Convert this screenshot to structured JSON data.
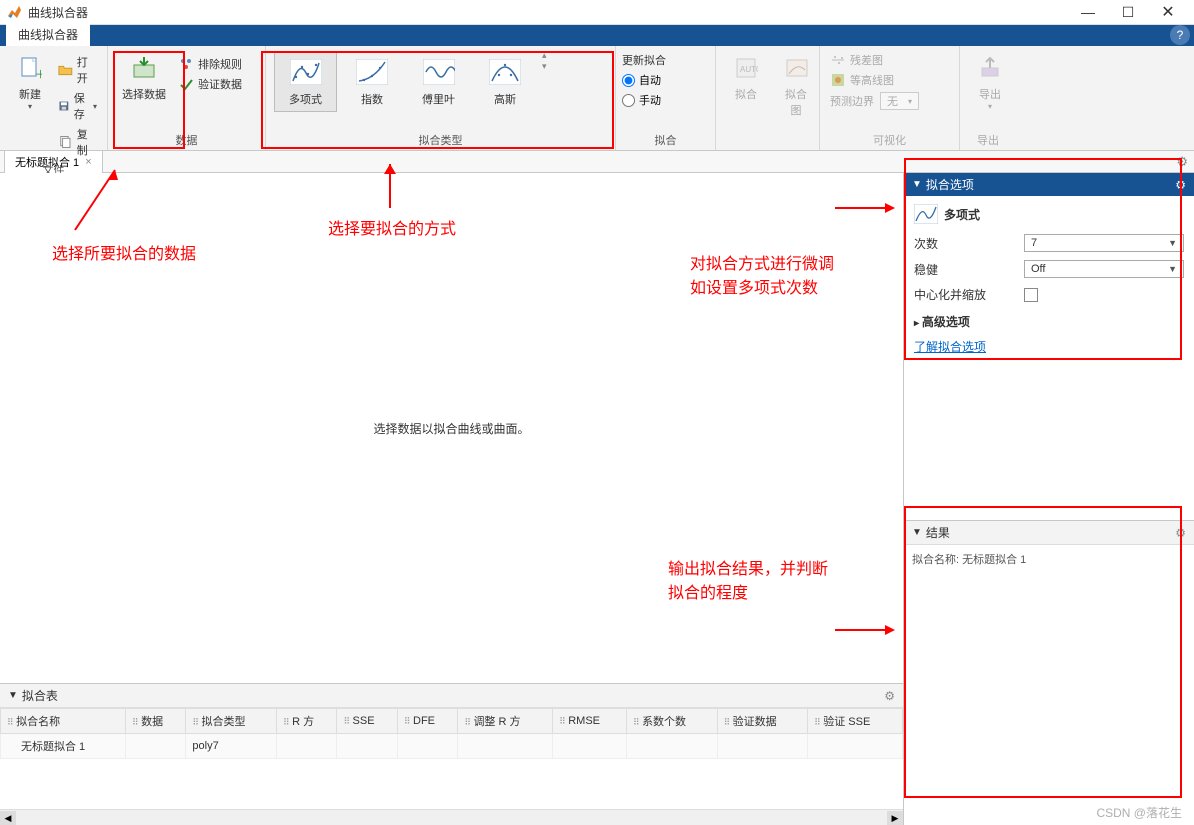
{
  "window": {
    "title": "曲线拟合器"
  },
  "ribbon": {
    "tab": "曲线拟合器",
    "file": {
      "new": "新建",
      "open": "打开",
      "save": "保存",
      "copy": "复制",
      "label": "文件"
    },
    "data": {
      "select": "选择数据",
      "exclude": "排除规则",
      "validate": "验证数据",
      "label": "数据"
    },
    "fittype": {
      "poly": "多项式",
      "exp": "指数",
      "fourier": "傅里叶",
      "gauss": "高斯",
      "label": "拟合类型"
    },
    "update": {
      "title": "更新拟合",
      "auto": "自动",
      "manual": "手动",
      "fit": "拟合",
      "label": "拟合"
    },
    "viz": {
      "resid": "残差图",
      "contour": "等高线图",
      "predbound": "预测边界",
      "predsel": "无",
      "label": "可视化"
    },
    "export": {
      "btn": "导出",
      "label": "导出"
    }
  },
  "doctab": {
    "name": "无标题拟合 1"
  },
  "canvas": {
    "msg": "选择数据以拟合曲线或曲面。"
  },
  "options": {
    "title": "拟合选项",
    "type": "多项式",
    "degreeLabel": "次数",
    "degreeVal": "7",
    "robustLabel": "稳健",
    "robustVal": "Off",
    "centerLabel": "中心化并缩放",
    "advLabel": "高级选项",
    "learn": "了解拟合选项"
  },
  "results": {
    "title": "结果",
    "fitname": "拟合名称: 无标题拟合 1"
  },
  "table": {
    "title": "拟合表",
    "cols": [
      "拟合名称",
      "数据",
      "拟合类型",
      "R 方",
      "SSE",
      "DFE",
      "调整 R 方",
      "RMSE",
      "系数个数",
      "验证数据",
      "验证 SSE"
    ],
    "row": {
      "name": "无标题拟合 1",
      "type": "poly7"
    }
  },
  "annot": {
    "a1": "选择所要拟合的数据",
    "a2": "选择要拟合的方式",
    "a3a": "对拟合方式进行微调",
    "a3b": "如设置多项式次数",
    "a4a": "输出拟合结果，并判断",
    "a4b": "拟合的程度"
  },
  "watermark": "CSDN @落花生"
}
